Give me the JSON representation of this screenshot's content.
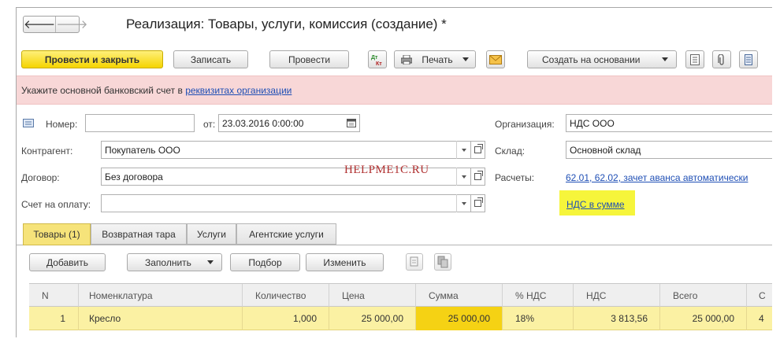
{
  "window": {
    "title": "Реализация: Товары, услуги, комиссия (создание) *"
  },
  "nav": {
    "back": "🡐",
    "forward": "🡒"
  },
  "toolbar": {
    "post_close": "Провести и закрыть",
    "save": "Записать",
    "post": "Провести",
    "dtkt_top": "Дт",
    "dtkt_bottom": "Кт",
    "print": "Печать",
    "create_based": "Создать на основании"
  },
  "banner": {
    "text": "Укажите основной банковский счет в ",
    "link": "реквизитах организации"
  },
  "form": {
    "number_label": "Номер:",
    "number_value": "",
    "date_label": "от:",
    "date_value": "23.03.2016  0:00:00",
    "org_label": "Организация:",
    "org_value": "НДС ООО",
    "counterparty_label": "Контрагент:",
    "counterparty_value": "Покупатель ООО",
    "warehouse_label": "Склад:",
    "warehouse_value": "Основной склад",
    "contract_label": "Договор:",
    "contract_value": "Без договора",
    "settlements_label": "Расчеты:",
    "settlements_link": "62.01, 62.02, зачет аванса автоматически",
    "invoice_label": "Счет на оплату:",
    "invoice_value": "",
    "vat_link": "НДС в сумме"
  },
  "watermark": "HELPME1C.RU",
  "tabs": [
    "Товары (1)",
    "Возвратная тара",
    "Услуги",
    "Агентские услуги"
  ],
  "table_toolbar": {
    "add": "Добавить",
    "fill": "Заполнить",
    "pick": "Подбор",
    "change": "Изменить"
  },
  "table": {
    "columns": [
      "N",
      "Номенклатура",
      "Количество",
      "Цена",
      "Сумма",
      "% НДС",
      "НДС",
      "Всего",
      "С"
    ],
    "rows": [
      {
        "n": "1",
        "item": "Кресло",
        "qty": "1,000",
        "price": "25 000,00",
        "sum": "25 000,00",
        "vat_rate": "18%",
        "vat": "3 813,56",
        "total": "25 000,00",
        "extra": "4"
      }
    ]
  },
  "colors": {
    "primary_button": "#f5d400",
    "banner_bg": "#f8d7d7",
    "link": "#1f4fb5",
    "highlight": "#f6f53b",
    "row_selected": "#fbf1a3"
  }
}
